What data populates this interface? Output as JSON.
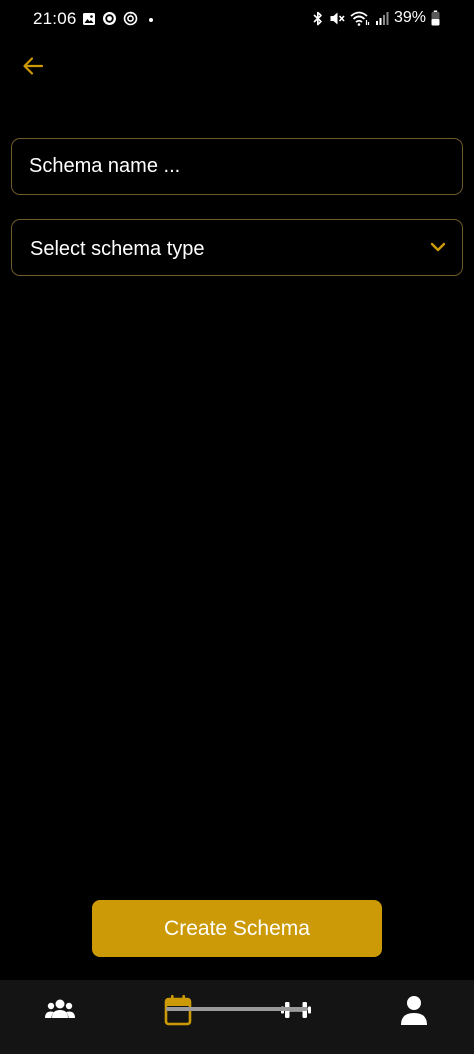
{
  "status_bar": {
    "time": "21:06",
    "battery": "39%",
    "left_icons": [
      "image-icon",
      "target-icon",
      "sync-icon",
      "dot-icon"
    ],
    "right_icons": [
      "bluetooth-icon",
      "mute-icon",
      "wifi-icon",
      "signal-icon",
      "battery-icon"
    ]
  },
  "header": {
    "back_icon": "arrow-left-icon"
  },
  "form": {
    "name_placeholder": "Schema name ...",
    "name_value": "",
    "type_placeholder": "Select schema type",
    "type_icon": "chevron-down-icon"
  },
  "actions": {
    "create_label": "Create Schema"
  },
  "bottom_nav": {
    "items": [
      {
        "icon": "users-icon",
        "active": false
      },
      {
        "icon": "calendar-icon",
        "active": true
      },
      {
        "icon": "dumbbell-icon",
        "active": false
      },
      {
        "icon": "user-icon",
        "active": false
      }
    ]
  },
  "colors": {
    "accent": "#cc9a06",
    "background": "#000000",
    "field_border": "#6e5a2a",
    "nav_background": "#141414"
  }
}
